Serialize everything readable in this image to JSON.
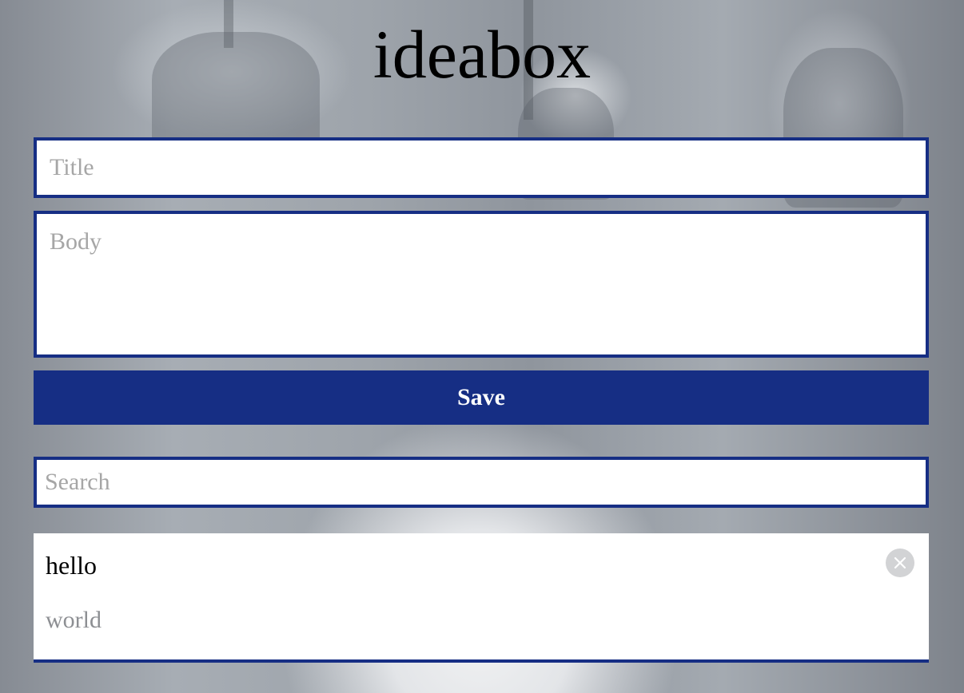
{
  "app": {
    "title": "ideabox"
  },
  "form": {
    "title_placeholder": "Title",
    "body_placeholder": "Body",
    "save_label": "Save"
  },
  "search": {
    "placeholder": "Search"
  },
  "ideas": [
    {
      "title": "hello",
      "body": "world",
      "delete_icon": "close-icon"
    }
  ],
  "colors": {
    "accent": "#162e84",
    "placeholder": "#a6a6a6",
    "idea_body": "#8d8f93",
    "delete_bg": "#d2d3d5"
  }
}
